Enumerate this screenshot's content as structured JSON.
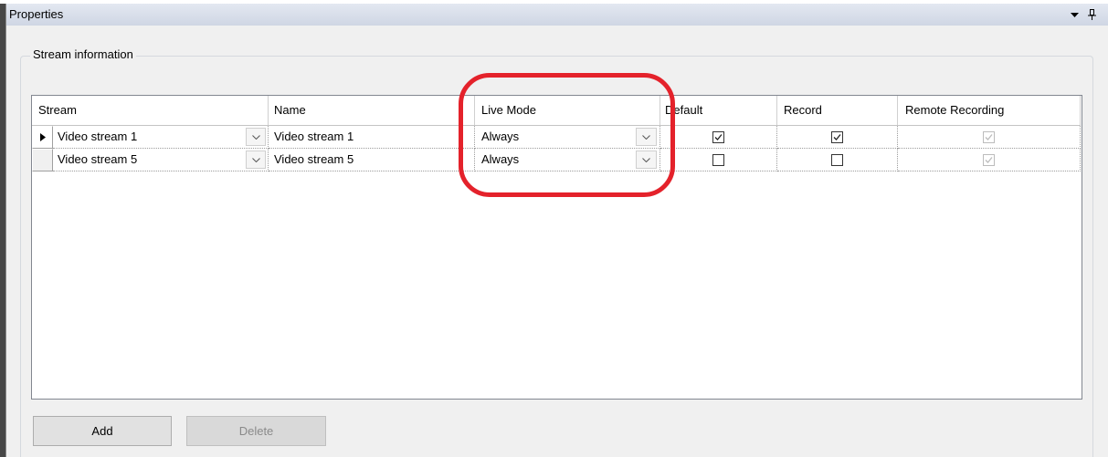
{
  "panel": {
    "title": "Properties"
  },
  "group": {
    "label": "Stream information"
  },
  "grid": {
    "columns": {
      "stream": "Stream",
      "name": "Name",
      "live_mode": "Live Mode",
      "default": "Default",
      "record": "Record",
      "remote_recording": "Remote Recording"
    },
    "rows": [
      {
        "current": true,
        "stream": "Video stream 1",
        "name": "Video stream 1",
        "live_mode": "Always",
        "default": true,
        "record": true,
        "remote_recording": true
      },
      {
        "current": false,
        "stream": "Video stream 5",
        "name": "Video stream 5",
        "live_mode": "Always",
        "default": false,
        "record": false,
        "remote_recording": true
      }
    ],
    "remote_recording_enabled": false
  },
  "buttons": {
    "add_label": "Add",
    "delete_label": "Delete",
    "add_enabled": true,
    "delete_enabled": false
  },
  "icons": {
    "title_menu": "dropdown-arrow-icon",
    "title_pin": "pin-icon",
    "row_selector": "current-row-arrow-icon",
    "combo": "chevron-down-icon",
    "checkbox": "checkmark-icon"
  },
  "colors": {
    "annotation": "#e4222b"
  }
}
